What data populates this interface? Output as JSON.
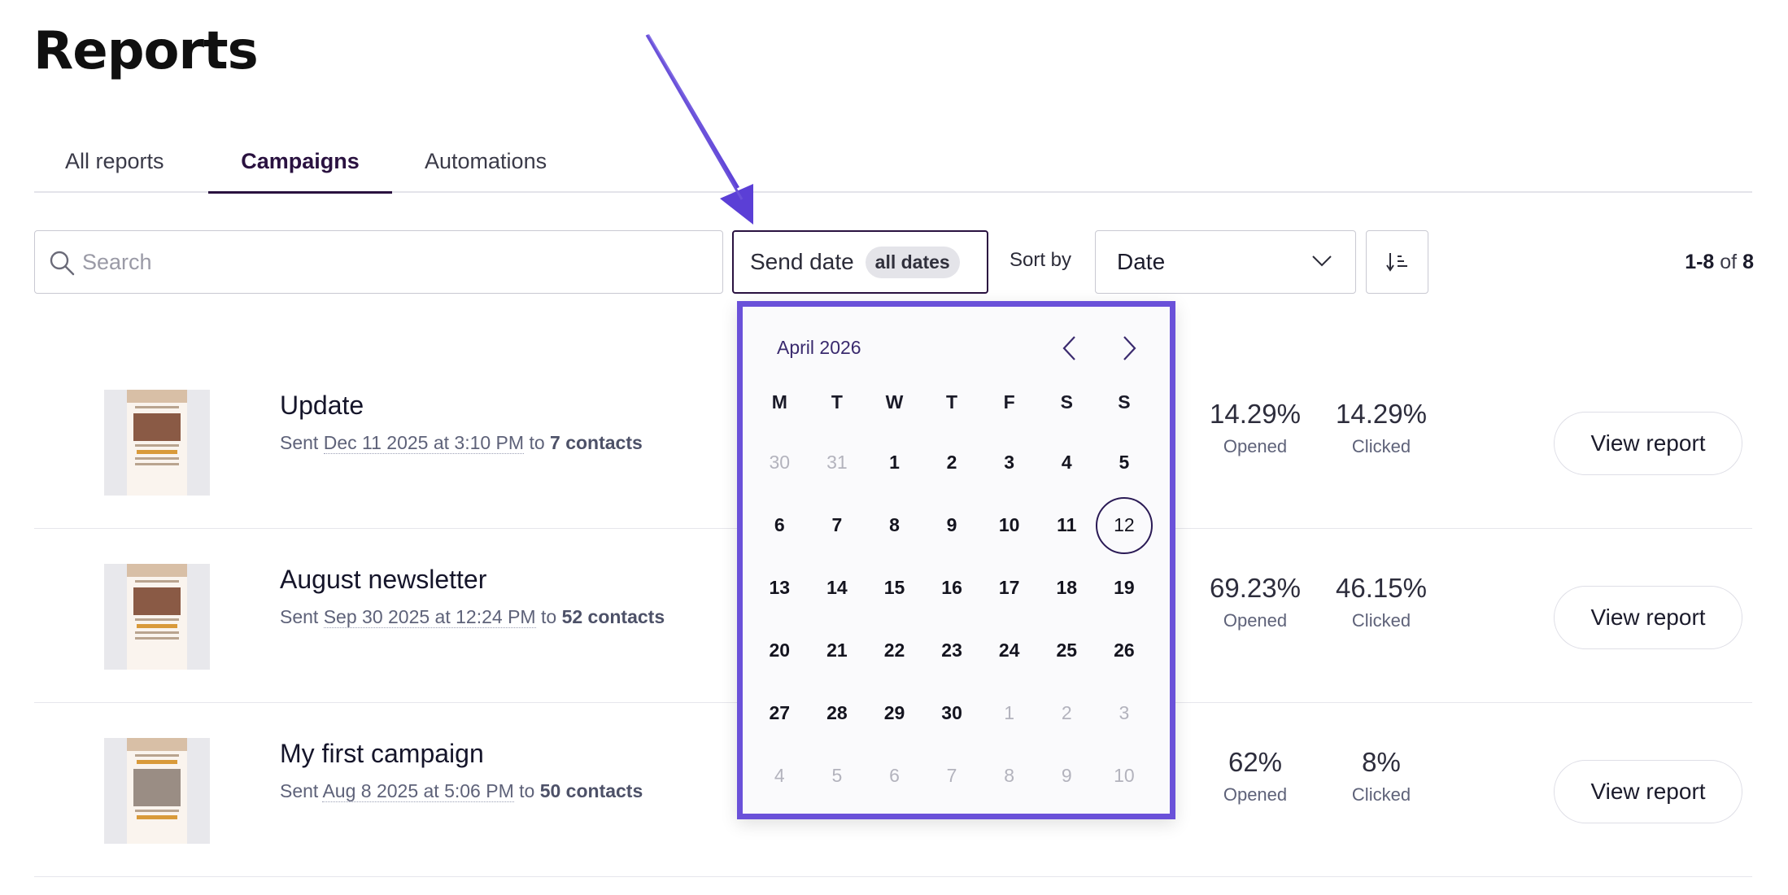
{
  "page": {
    "title": "Reports"
  },
  "tabs": [
    {
      "label": "All reports",
      "active": false
    },
    {
      "label": "Campaigns",
      "active": true
    },
    {
      "label": "Automations",
      "active": false
    }
  ],
  "toolbar": {
    "search_placeholder": "Search",
    "send_date_label": "Send date",
    "send_date_value": "all dates",
    "sort_label": "Sort by",
    "sort_value": "Date",
    "pagination_range": "1-8",
    "pagination_of": "of",
    "pagination_total": "8"
  },
  "campaigns": [
    {
      "name": "Update",
      "sent_prefix": "Sent",
      "sent_date": "Dec 11 2025 at 3:10 PM",
      "to": "to",
      "contacts": "7 contacts",
      "opened": "14.29%",
      "opened_label": "Opened",
      "clicked": "14.29%",
      "clicked_label": "Clicked",
      "button": "View report"
    },
    {
      "name": "August newsletter",
      "sent_prefix": "Sent",
      "sent_date": "Sep 30 2025 at 12:24 PM",
      "to": "to",
      "contacts": "52 contacts",
      "opened": "69.23%",
      "opened_label": "Opened",
      "clicked": "46.15%",
      "clicked_label": "Clicked",
      "button": "View report"
    },
    {
      "name": "My first campaign",
      "sent_prefix": "Sent",
      "sent_date": "Aug 8 2025 at 5:06 PM",
      "to": "to",
      "contacts": "50 contacts",
      "opened": "62%",
      "opened_label": "Opened",
      "clicked": "8%",
      "clicked_label": "Clicked",
      "button": "View report"
    }
  ],
  "calendar": {
    "month_label": "April 2026",
    "weekdays": [
      "M",
      "T",
      "W",
      "T",
      "F",
      "S",
      "S"
    ],
    "weeks": [
      [
        {
          "d": "30",
          "muted": true
        },
        {
          "d": "31",
          "muted": true
        },
        {
          "d": "1"
        },
        {
          "d": "2"
        },
        {
          "d": "3"
        },
        {
          "d": "4"
        },
        {
          "d": "5"
        }
      ],
      [
        {
          "d": "6"
        },
        {
          "d": "7"
        },
        {
          "d": "8"
        },
        {
          "d": "9"
        },
        {
          "d": "10"
        },
        {
          "d": "11"
        },
        {
          "d": "12",
          "today": true
        }
      ],
      [
        {
          "d": "13"
        },
        {
          "d": "14"
        },
        {
          "d": "15"
        },
        {
          "d": "16"
        },
        {
          "d": "17"
        },
        {
          "d": "18"
        },
        {
          "d": "19"
        }
      ],
      [
        {
          "d": "20"
        },
        {
          "d": "21"
        },
        {
          "d": "22"
        },
        {
          "d": "23"
        },
        {
          "d": "24"
        },
        {
          "d": "25"
        },
        {
          "d": "26"
        }
      ],
      [
        {
          "d": "27"
        },
        {
          "d": "28"
        },
        {
          "d": "29"
        },
        {
          "d": "30"
        },
        {
          "d": "1",
          "muted": true
        },
        {
          "d": "2",
          "muted": true
        },
        {
          "d": "3",
          "muted": true
        }
      ],
      [
        {
          "d": "4",
          "muted": true
        },
        {
          "d": "5",
          "muted": true
        },
        {
          "d": "6",
          "muted": true
        },
        {
          "d": "7",
          "muted": true
        },
        {
          "d": "8",
          "muted": true
        },
        {
          "d": "9",
          "muted": true
        },
        {
          "d": "10",
          "muted": true
        }
      ]
    ]
  },
  "colors": {
    "accent": "#6a51d9",
    "active_tab": "#2a1240",
    "today_ring": "#2a1a55"
  },
  "icons": {
    "search": "search-icon",
    "sort_chevron": "chevron-down-icon",
    "sort_order": "sort-order-icon",
    "prev": "chevron-left-icon",
    "next": "chevron-right-icon",
    "annotation": "arrow-annotation-icon"
  }
}
